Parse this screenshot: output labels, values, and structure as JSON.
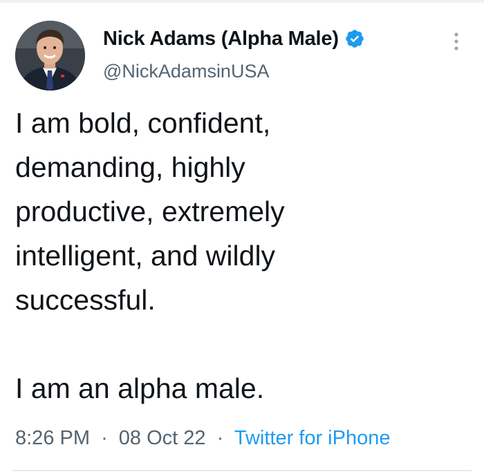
{
  "user": {
    "display_name": "Nick Adams (Alpha Male)",
    "handle": "@NickAdamsinUSA",
    "verified_icon": "verified-badge-icon",
    "avatar": "profile-photo"
  },
  "tweet": {
    "lines_para1": [
      "I am bold, confident,",
      "demanding, highly",
      "productive, extremely",
      "intelligent, and wildly",
      "successful."
    ],
    "line_para2": "I am an alpha male."
  },
  "meta": {
    "time": "8:26 PM",
    "separator": "·",
    "date": "08 Oct 22",
    "source": "Twitter for iPhone"
  },
  "colors": {
    "text": "#0f1419",
    "secondary": "#536471",
    "link": "#1d9bf0"
  }
}
